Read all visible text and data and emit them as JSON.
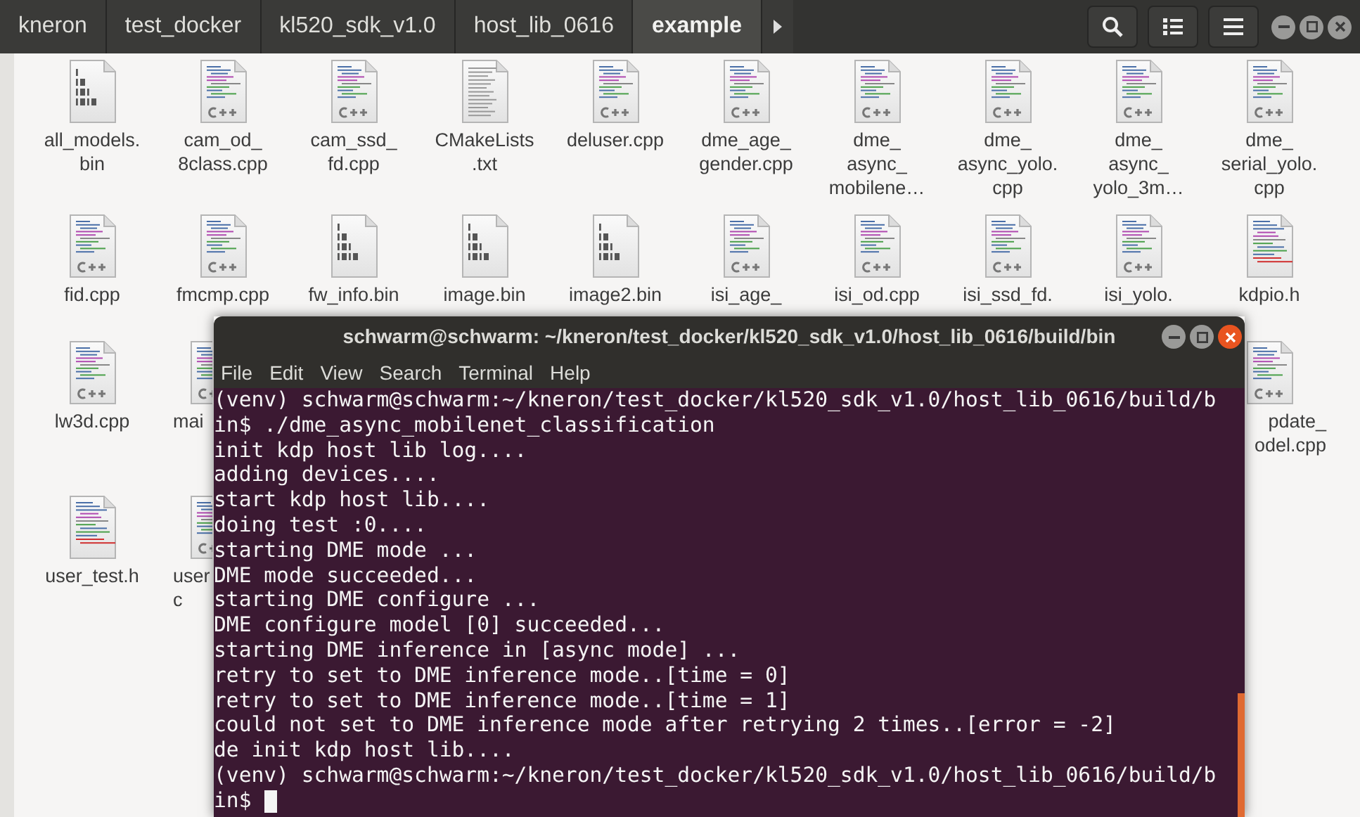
{
  "breadcrumbs": [
    {
      "label": "kneron",
      "selected": false
    },
    {
      "label": "test_docker",
      "selected": false
    },
    {
      "label": "kl520_sdk_v1.0",
      "selected": false
    },
    {
      "label": "host_lib_0616",
      "selected": false
    },
    {
      "label": "example",
      "selected": true
    }
  ],
  "files": {
    "rows": [
      {
        "items": [
          {
            "label": "all_models.\nbin",
            "kind": "bin"
          },
          {
            "label": "cam_od_\n8class.cpp",
            "kind": "cpp"
          },
          {
            "label": "cam_ssd_\nfd.cpp",
            "kind": "cpp"
          },
          {
            "label": "CMakeLists\n.txt",
            "kind": "txt"
          },
          {
            "label": "deluser.cpp",
            "kind": "cpp"
          },
          {
            "label": "dme_age_\ngender.cpp",
            "kind": "cpp"
          },
          {
            "label": "dme_\nasync_\nmobilene…",
            "kind": "cpp"
          },
          {
            "label": "dme_\nasync_yolo.\ncpp",
            "kind": "cpp"
          },
          {
            "label": "dme_\nasync_\nyolo_3m…",
            "kind": "cpp"
          },
          {
            "label": "dme_\nserial_yolo.\ncpp",
            "kind": "cpp"
          }
        ]
      },
      {
        "items": [
          {
            "label": "fid.cpp",
            "kind": "cpp"
          },
          {
            "label": "fmcmp.cpp",
            "kind": "cpp"
          },
          {
            "label": "fw_info.bin",
            "kind": "bin"
          },
          {
            "label": "image.bin",
            "kind": "bin"
          },
          {
            "label": "image2.bin",
            "kind": "bin"
          },
          {
            "label": "isi_age_",
            "kind": "cpp"
          },
          {
            "label": "isi_od.cpp",
            "kind": "cpp"
          },
          {
            "label": "isi_ssd_fd.",
            "kind": "cpp"
          },
          {
            "label": "isi_yolo.",
            "kind": "cpp"
          },
          {
            "label": "kdpio.h",
            "kind": "h"
          }
        ]
      },
      {
        "items": [
          {
            "label": "lw3d.cpp",
            "kind": "cpp"
          },
          {
            "label": "mai",
            "kind": "cpp",
            "clipped": true
          }
        ],
        "trailing": [
          {
            "label": "pdate_\nodel.cpp",
            "kind": "cpp",
            "clipped": true
          }
        ]
      },
      {
        "items": [
          {
            "label": "user_test.h",
            "kind": "h"
          },
          {
            "label": "user\nc",
            "kind": "cpp",
            "clipped": true
          }
        ]
      }
    ]
  },
  "terminal": {
    "title": "schwarm@schwarm: ~/kneron/test_docker/kl520_sdk_v1.0/host_lib_0616/build/bin",
    "menu": [
      "File",
      "Edit",
      "View",
      "Search",
      "Terminal",
      "Help"
    ],
    "lines": [
      "(venv) schwarm@schwarm:~/kneron/test_docker/kl520_sdk_v1.0/host_lib_0616/build/b",
      "in$ ./dme_async_mobilenet_classification",
      "init kdp host lib log....",
      "adding devices....",
      "start kdp host lib....",
      "doing test :0....",
      "starting DME mode ...",
      "DME mode succeeded...",
      "starting DME configure ...",
      "DME configure model [0] succeeded...",
      "starting DME inference in [async mode] ...",
      "retry to set to DME inference mode..[time = 0]",
      "retry to set to DME inference mode..[time = 1]",
      "could not set to DME inference mode after retrying 2 times..[error = -2]",
      "de init kdp host lib....",
      "(venv) schwarm@schwarm:~/kneron/test_docker/kl520_sdk_v1.0/host_lib_0616/build/b",
      "in$ "
    ],
    "cursor": true
  }
}
